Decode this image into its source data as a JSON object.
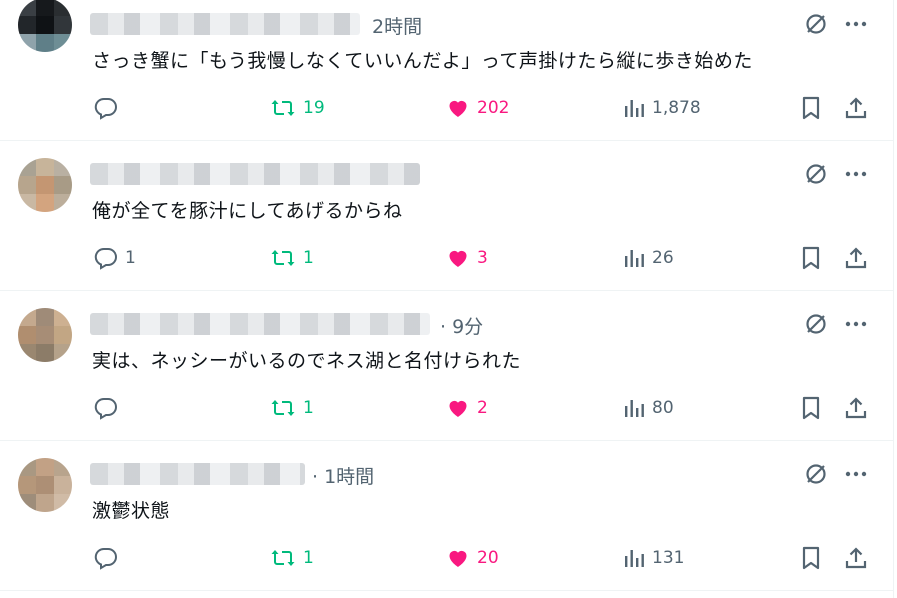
{
  "posts": [
    {
      "time": "2時間",
      "text": "さっき蟹に「もう我慢しなくていいんだよ」って声掛けたら縦に歩き始めた",
      "replies": "",
      "reposts": "19",
      "likes": "202",
      "views": "1,878"
    },
    {
      "time": "",
      "text": "俺が全てを豚汁にしてあげるからね",
      "replies": "1",
      "reposts": "1",
      "likes": "3",
      "views": "26"
    },
    {
      "time": "· 9分",
      "text": "実は、ネッシーがいるのでネス湖と名付けられた",
      "replies": "",
      "reposts": "1",
      "likes": "2",
      "views": "80"
    },
    {
      "time": "· 1時間",
      "text": "激鬱状態",
      "replies": "",
      "reposts": "1",
      "likes": "20",
      "views": "131"
    }
  ],
  "colors": {
    "repost": "#00ba7c",
    "like": "#f91880",
    "icon": "#536471",
    "divider": "#eff3f4"
  },
  "icons": [
    "grok-icon",
    "more-icon",
    "reply-icon",
    "repost-icon",
    "like-icon",
    "views-icon",
    "bookmark-icon",
    "share-icon"
  ]
}
